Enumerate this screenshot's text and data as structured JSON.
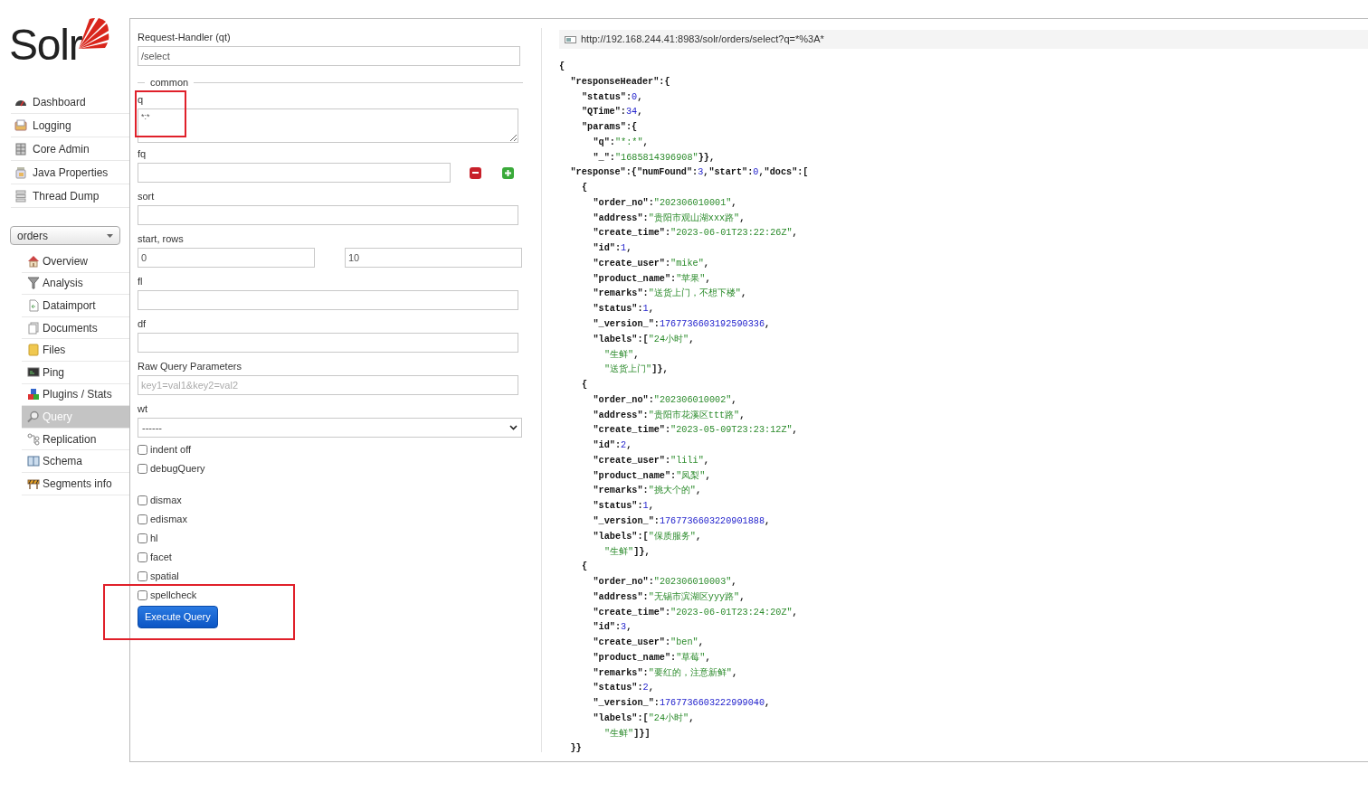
{
  "sidebar": {
    "logo": {
      "text": "Solr"
    },
    "main_menu": [
      {
        "label": "Dashboard"
      },
      {
        "label": "Logging"
      },
      {
        "label": "Core Admin"
      },
      {
        "label": "Java Properties"
      },
      {
        "label": "Thread Dump"
      }
    ],
    "core_selector": {
      "value": "orders"
    },
    "core_menu": [
      {
        "label": "Overview",
        "selected": false
      },
      {
        "label": "Analysis",
        "selected": false
      },
      {
        "label": "Dataimport",
        "selected": false
      },
      {
        "label": "Documents",
        "selected": false
      },
      {
        "label": "Files",
        "selected": false
      },
      {
        "label": "Ping",
        "selected": false
      },
      {
        "label": "Plugins / Stats",
        "selected": false
      },
      {
        "label": "Query",
        "selected": true
      },
      {
        "label": "Replication",
        "selected": false
      },
      {
        "label": "Schema",
        "selected": false
      },
      {
        "label": "Segments info",
        "selected": false
      }
    ]
  },
  "form": {
    "request_handler": {
      "label": "Request-Handler (qt)",
      "value": "/select"
    },
    "section_legend": "common",
    "fields": [
      {
        "kind": "textarea",
        "label": "q",
        "value": "*:*"
      },
      {
        "kind": "input_with_buttons",
        "label": "fq"
      },
      {
        "kind": "input",
        "label": "sort"
      },
      {
        "kind": "pair",
        "label": "start, rows",
        "values": [
          "0",
          "10"
        ]
      },
      {
        "kind": "input",
        "label": "fl"
      },
      {
        "kind": "input",
        "label": "df"
      },
      {
        "kind": "input",
        "label": "Raw Query Parameters",
        "placeholder": "key1=val1&key2=val2"
      },
      {
        "kind": "select",
        "label": "wt",
        "value": "------"
      }
    ],
    "options": [
      {
        "label": "indent off",
        "checked": false
      },
      {
        "label": "debugQuery",
        "checked": false
      }
    ],
    "parsers": [
      {
        "label": "dismax",
        "checked": false
      },
      {
        "label": "edismax",
        "checked": false
      },
      {
        "label": "hl",
        "checked": false
      },
      {
        "label": "facet",
        "checked": false
      },
      {
        "label": "spatial",
        "checked": false
      },
      {
        "label": "spellcheck",
        "checked": false
      }
    ],
    "execute_button": "Execute Query"
  },
  "result": {
    "url": "http://192.168.244.41:8983/solr/orders/select?q=*%3A*",
    "lines": [
      {
        "tokens": [
          {
            "kind": "punct",
            "text": "{"
          }
        ],
        "children": [
          {
            "tokens": [
              {
                "kind": "key",
                "text": "\"responseHeader\""
              },
              {
                "kind": "punct",
                "text": ":{"
              }
            ],
            "children": [
              {
                "tokens": [
                  {
                    "kind": "key",
                    "text": "\"status\""
                  },
                  {
                    "kind": "punct",
                    "text": ":"
                  },
                  {
                    "kind": "number",
                    "text": "0"
                  },
                  {
                    "kind": "punct",
                    "text": ","
                  }
                ]
              },
              {
                "tokens": [
                  {
                    "kind": "key",
                    "text": "\"QTime\""
                  },
                  {
                    "kind": "punct",
                    "text": ":"
                  },
                  {
                    "kind": "number",
                    "text": "34"
                  },
                  {
                    "kind": "punct",
                    "text": ","
                  }
                ]
              },
              {
                "tokens": [
                  {
                    "kind": "key",
                    "text": "\"params\""
                  },
                  {
                    "kind": "punct",
                    "text": ":{"
                  }
                ],
                "children": [
                  {
                    "tokens": [
                      {
                        "kind": "key",
                        "text": "\"q\""
                      },
                      {
                        "kind": "punct",
                        "text": ":"
                      },
                      {
                        "kind": "string",
                        "text": "\"*:*\""
                      },
                      {
                        "kind": "punct",
                        "text": ","
                      }
                    ]
                  },
                  {
                    "tokens": [
                      {
                        "kind": "key",
                        "text": "\"_\""
                      },
                      {
                        "kind": "punct",
                        "text": ":"
                      },
                      {
                        "kind": "string",
                        "text": "\"1685814396908\""
                      },
                      {
                        "kind": "punct",
                        "text": "}},"
                      }
                    ]
                  }
                ]
              }
            ]
          },
          {
            "tokens": [
              {
                "kind": "key",
                "text": "\"response\""
              },
              {
                "kind": "punct",
                "text": ":{"
              },
              {
                "kind": "key",
                "text": "\"numFound\""
              },
              {
                "kind": "punct",
                "text": ":"
              },
              {
                "kind": "number",
                "text": "3"
              },
              {
                "kind": "punct",
                "text": ","
              },
              {
                "kind": "key",
                "text": "\"start\""
              },
              {
                "kind": "punct",
                "text": ":"
              },
              {
                "kind": "number",
                "text": "0"
              },
              {
                "kind": "punct",
                "text": ","
              },
              {
                "kind": "key",
                "text": "\"docs\""
              },
              {
                "kind": "punct",
                "text": ":["
              }
            ],
            "children": [
              {
                "tokens": [
                  {
                    "kind": "punct",
                    "text": "{"
                  }
                ],
                "children": [
                  {
                    "tokens": [
                      {
                        "kind": "key",
                        "text": "\"order_no\""
                      },
                      {
                        "kind": "punct",
                        "text": ":"
                      },
                      {
                        "kind": "string",
                        "text": "\"202306010001\""
                      },
                      {
                        "kind": "punct",
                        "text": ","
                      }
                    ]
                  },
                  {
                    "tokens": [
                      {
                        "kind": "key",
                        "text": "\"address\""
                      },
                      {
                        "kind": "punct",
                        "text": ":"
                      },
                      {
                        "kind": "string",
                        "text": "\"贵阳市观山湖xxx路\""
                      },
                      {
                        "kind": "punct",
                        "text": ","
                      }
                    ]
                  },
                  {
                    "tokens": [
                      {
                        "kind": "key",
                        "text": "\"create_time\""
                      },
                      {
                        "kind": "punct",
                        "text": ":"
                      },
                      {
                        "kind": "string",
                        "text": "\"2023-06-01T23:22:26Z\""
                      },
                      {
                        "kind": "punct",
                        "text": ","
                      }
                    ]
                  },
                  {
                    "tokens": [
                      {
                        "kind": "key",
                        "text": "\"id\""
                      },
                      {
                        "kind": "punct",
                        "text": ":"
                      },
                      {
                        "kind": "number",
                        "text": "1"
                      },
                      {
                        "kind": "punct",
                        "text": ","
                      }
                    ]
                  },
                  {
                    "tokens": [
                      {
                        "kind": "key",
                        "text": "\"create_user\""
                      },
                      {
                        "kind": "punct",
                        "text": ":"
                      },
                      {
                        "kind": "string",
                        "text": "\"mike\""
                      },
                      {
                        "kind": "punct",
                        "text": ","
                      }
                    ]
                  },
                  {
                    "tokens": [
                      {
                        "kind": "key",
                        "text": "\"product_name\""
                      },
                      {
                        "kind": "punct",
                        "text": ":"
                      },
                      {
                        "kind": "string",
                        "text": "\"苹果\""
                      },
                      {
                        "kind": "punct",
                        "text": ","
                      }
                    ]
                  },
                  {
                    "tokens": [
                      {
                        "kind": "key",
                        "text": "\"remarks\""
                      },
                      {
                        "kind": "punct",
                        "text": ":"
                      },
                      {
                        "kind": "string",
                        "text": "\"送货上门，不想下楼\""
                      },
                      {
                        "kind": "punct",
                        "text": ","
                      }
                    ]
                  },
                  {
                    "tokens": [
                      {
                        "kind": "key",
                        "text": "\"status\""
                      },
                      {
                        "kind": "punct",
                        "text": ":"
                      },
                      {
                        "kind": "number",
                        "text": "1"
                      },
                      {
                        "kind": "punct",
                        "text": ","
                      }
                    ]
                  },
                  {
                    "tokens": [
                      {
                        "kind": "key",
                        "text": "\"_version_\""
                      },
                      {
                        "kind": "punct",
                        "text": ":"
                      },
                      {
                        "kind": "number",
                        "text": "1767736603192590336"
                      },
                      {
                        "kind": "punct",
                        "text": ","
                      }
                    ]
                  },
                  {
                    "tokens": [
                      {
                        "kind": "key",
                        "text": "\"labels\""
                      },
                      {
                        "kind": "punct",
                        "text": ":["
                      },
                      {
                        "kind": "string",
                        "text": "\"24小时\""
                      },
                      {
                        "kind": "punct",
                        "text": ","
                      }
                    ],
                    "children": [
                      {
                        "tokens": [
                          {
                            "kind": "string",
                            "text": "\"生鲜\""
                          },
                          {
                            "kind": "punct",
                            "text": ","
                          }
                        ]
                      },
                      {
                        "tokens": [
                          {
                            "kind": "string",
                            "text": "\"送货上门\""
                          },
                          {
                            "kind": "punct",
                            "text": "]},"
                          }
                        ]
                      }
                    ]
                  }
                ]
              },
              {
                "tokens": [
                  {
                    "kind": "punct",
                    "text": "{"
                  }
                ],
                "children": [
                  {
                    "tokens": [
                      {
                        "kind": "key",
                        "text": "\"order_no\""
                      },
                      {
                        "kind": "punct",
                        "text": ":"
                      },
                      {
                        "kind": "string",
                        "text": "\"202306010002\""
                      },
                      {
                        "kind": "punct",
                        "text": ","
                      }
                    ]
                  },
                  {
                    "tokens": [
                      {
                        "kind": "key",
                        "text": "\"address\""
                      },
                      {
                        "kind": "punct",
                        "text": ":"
                      },
                      {
                        "kind": "string",
                        "text": "\"贵阳市花溪区ttt路\""
                      },
                      {
                        "kind": "punct",
                        "text": ","
                      }
                    ]
                  },
                  {
                    "tokens": [
                      {
                        "kind": "key",
                        "text": "\"create_time\""
                      },
                      {
                        "kind": "punct",
                        "text": ":"
                      },
                      {
                        "kind": "string",
                        "text": "\"2023-05-09T23:23:12Z\""
                      },
                      {
                        "kind": "punct",
                        "text": ","
                      }
                    ]
                  },
                  {
                    "tokens": [
                      {
                        "kind": "key",
                        "text": "\"id\""
                      },
                      {
                        "kind": "punct",
                        "text": ":"
                      },
                      {
                        "kind": "number",
                        "text": "2"
                      },
                      {
                        "kind": "punct",
                        "text": ","
                      }
                    ]
                  },
                  {
                    "tokens": [
                      {
                        "kind": "key",
                        "text": "\"create_user\""
                      },
                      {
                        "kind": "punct",
                        "text": ":"
                      },
                      {
                        "kind": "string",
                        "text": "\"lili\""
                      },
                      {
                        "kind": "punct",
                        "text": ","
                      }
                    ]
                  },
                  {
                    "tokens": [
                      {
                        "kind": "key",
                        "text": "\"product_name\""
                      },
                      {
                        "kind": "punct",
                        "text": ":"
                      },
                      {
                        "kind": "string",
                        "text": "\"凤梨\""
                      },
                      {
                        "kind": "punct",
                        "text": ","
                      }
                    ]
                  },
                  {
                    "tokens": [
                      {
                        "kind": "key",
                        "text": "\"remarks\""
                      },
                      {
                        "kind": "punct",
                        "text": ":"
                      },
                      {
                        "kind": "string",
                        "text": "\"挑大个的\""
                      },
                      {
                        "kind": "punct",
                        "text": ","
                      }
                    ]
                  },
                  {
                    "tokens": [
                      {
                        "kind": "key",
                        "text": "\"status\""
                      },
                      {
                        "kind": "punct",
                        "text": ":"
                      },
                      {
                        "kind": "number",
                        "text": "1"
                      },
                      {
                        "kind": "punct",
                        "text": ","
                      }
                    ]
                  },
                  {
                    "tokens": [
                      {
                        "kind": "key",
                        "text": "\"_version_\""
                      },
                      {
                        "kind": "punct",
                        "text": ":"
                      },
                      {
                        "kind": "number",
                        "text": "1767736603220901888"
                      },
                      {
                        "kind": "punct",
                        "text": ","
                      }
                    ]
                  },
                  {
                    "tokens": [
                      {
                        "kind": "key",
                        "text": "\"labels\""
                      },
                      {
                        "kind": "punct",
                        "text": ":["
                      },
                      {
                        "kind": "string",
                        "text": "\"保质服务\""
                      },
                      {
                        "kind": "punct",
                        "text": ","
                      }
                    ],
                    "children": [
                      {
                        "tokens": [
                          {
                            "kind": "string",
                            "text": "\"生鲜\""
                          },
                          {
                            "kind": "punct",
                            "text": "]},"
                          }
                        ]
                      }
                    ]
                  }
                ]
              },
              {
                "tokens": [
                  {
                    "kind": "punct",
                    "text": "{"
                  }
                ],
                "children": [
                  {
                    "tokens": [
                      {
                        "kind": "key",
                        "text": "\"order_no\""
                      },
                      {
                        "kind": "punct",
                        "text": ":"
                      },
                      {
                        "kind": "string",
                        "text": "\"202306010003\""
                      },
                      {
                        "kind": "punct",
                        "text": ","
                      }
                    ]
                  },
                  {
                    "tokens": [
                      {
                        "kind": "key",
                        "text": "\"address\""
                      },
                      {
                        "kind": "punct",
                        "text": ":"
                      },
                      {
                        "kind": "string",
                        "text": "\"无锡市滨湖区yyy路\""
                      },
                      {
                        "kind": "punct",
                        "text": ","
                      }
                    ]
                  },
                  {
                    "tokens": [
                      {
                        "kind": "key",
                        "text": "\"create_time\""
                      },
                      {
                        "kind": "punct",
                        "text": ":"
                      },
                      {
                        "kind": "string",
                        "text": "\"2023-06-01T23:24:20Z\""
                      },
                      {
                        "kind": "punct",
                        "text": ","
                      }
                    ]
                  },
                  {
                    "tokens": [
                      {
                        "kind": "key",
                        "text": "\"id\""
                      },
                      {
                        "kind": "punct",
                        "text": ":"
                      },
                      {
                        "kind": "number",
                        "text": "3"
                      },
                      {
                        "kind": "punct",
                        "text": ","
                      }
                    ]
                  },
                  {
                    "tokens": [
                      {
                        "kind": "key",
                        "text": "\"create_user\""
                      },
                      {
                        "kind": "punct",
                        "text": ":"
                      },
                      {
                        "kind": "string",
                        "text": "\"ben\""
                      },
                      {
                        "kind": "punct",
                        "text": ","
                      }
                    ]
                  },
                  {
                    "tokens": [
                      {
                        "kind": "key",
                        "text": "\"product_name\""
                      },
                      {
                        "kind": "punct",
                        "text": ":"
                      },
                      {
                        "kind": "string",
                        "text": "\"草莓\""
                      },
                      {
                        "kind": "punct",
                        "text": ","
                      }
                    ]
                  },
                  {
                    "tokens": [
                      {
                        "kind": "key",
                        "text": "\"remarks\""
                      },
                      {
                        "kind": "punct",
                        "text": ":"
                      },
                      {
                        "kind": "string",
                        "text": "\"要红的，注意新鲜\""
                      },
                      {
                        "kind": "punct",
                        "text": ","
                      }
                    ]
                  },
                  {
                    "tokens": [
                      {
                        "kind": "key",
                        "text": "\"status\""
                      },
                      {
                        "kind": "punct",
                        "text": ":"
                      },
                      {
                        "kind": "number",
                        "text": "2"
                      },
                      {
                        "kind": "punct",
                        "text": ","
                      }
                    ]
                  },
                  {
                    "tokens": [
                      {
                        "kind": "key",
                        "text": "\"_version_\""
                      },
                      {
                        "kind": "punct",
                        "text": ":"
                      },
                      {
                        "kind": "number",
                        "text": "1767736603222999040"
                      },
                      {
                        "kind": "punct",
                        "text": ","
                      }
                    ]
                  },
                  {
                    "tokens": [
                      {
                        "kind": "key",
                        "text": "\"labels\""
                      },
                      {
                        "kind": "punct",
                        "text": ":["
                      },
                      {
                        "kind": "string",
                        "text": "\"24小时\""
                      },
                      {
                        "kind": "punct",
                        "text": ","
                      }
                    ],
                    "children": [
                      {
                        "tokens": [
                          {
                            "kind": "string",
                            "text": "\"生鲜\""
                          },
                          {
                            "kind": "punct",
                            "text": "]}]"
                          }
                        ]
                      }
                    ]
                  }
                ]
              }
            ]
          },
          {
            "tokens": [
              {
                "kind": "punct",
                "text": "}}"
              }
            ]
          }
        ]
      }
    ]
  }
}
